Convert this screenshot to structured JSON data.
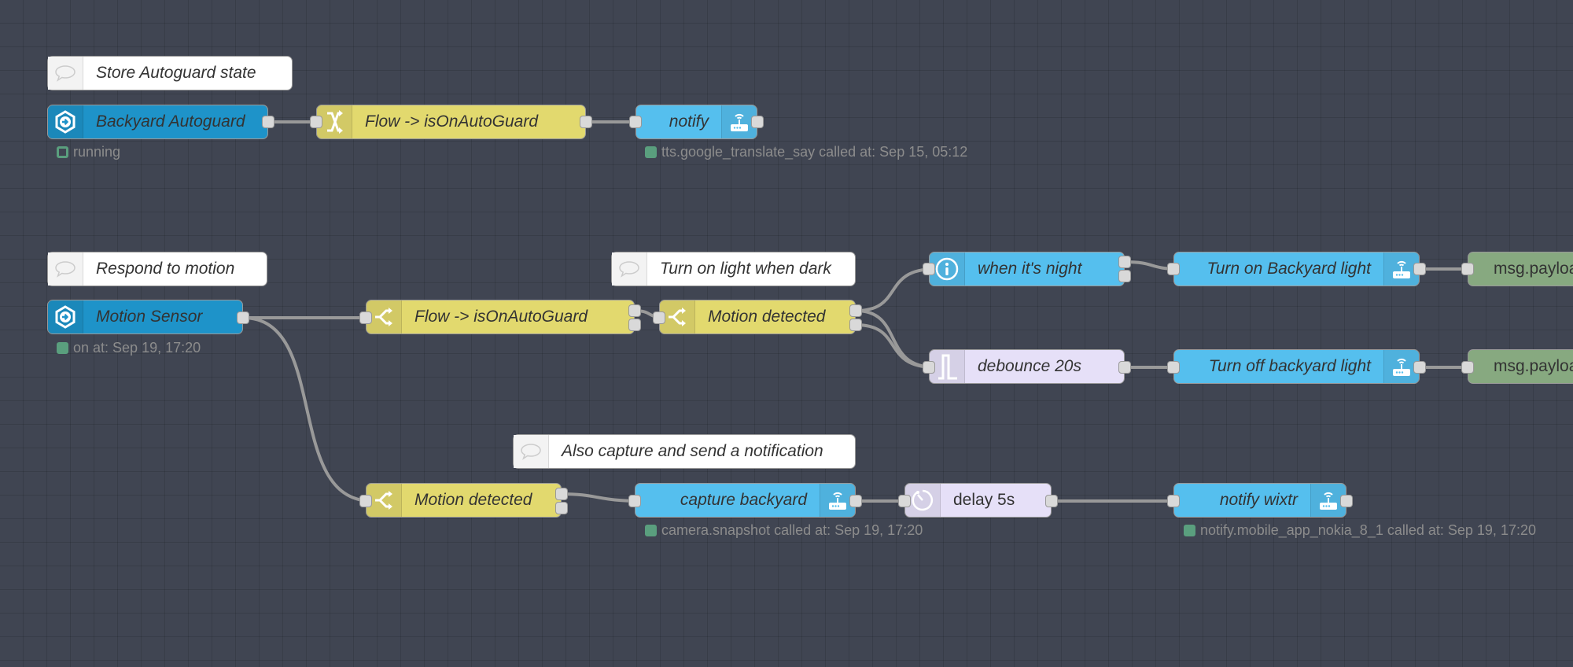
{
  "colors": {
    "canvas": "#404552",
    "ha_server_node": "#1e93c9",
    "ha_service_node": "#55bfee",
    "function_node": "#e2d96e",
    "timing_node": "#e6e0f8",
    "output_node": "#87a980",
    "comment_node": "#ffffff",
    "wire": "#999999",
    "status_ok": "#5a9f7e"
  },
  "flow1": {
    "comment": "Store Autoguard state",
    "trigger": {
      "label": "Backyard Autoguard",
      "icon": "ha-event-icon",
      "status": "running",
      "status_shape": "ring"
    },
    "change": {
      "label": "Flow -> isOnAutoGuard",
      "icon": "shuffle-icon"
    },
    "service": {
      "label": "notify",
      "icon": "router-icon",
      "status": "tts.google_translate_say called at: Sep 15, 05:12"
    }
  },
  "flow2": {
    "comment": "Respond to motion",
    "sensor": {
      "label": "Motion Sensor",
      "icon": "ha-event-icon",
      "status": "on at: Sep 19, 17:20"
    },
    "switch_guard": {
      "label": "Flow -> isOnAutoGuard",
      "icon": "switch-icon"
    },
    "comment_light": "Turn on light when dark",
    "switch_motion_light": {
      "label": "Motion detected",
      "icon": "switch-icon"
    },
    "night_check": {
      "label": "when it's night",
      "icon": "info-icon"
    },
    "debounce": {
      "label": "debounce 20s",
      "icon": "pulse-icon"
    },
    "light_on": {
      "label": "Turn on Backyard light",
      "icon": "router-icon"
    },
    "light_off": {
      "label": "Turn off backyard light",
      "icon": "router-icon"
    },
    "debug_on": {
      "label": "msg.payload"
    },
    "debug_off": {
      "label": "msg.payload"
    },
    "comment_capture": "Also capture and send a notification",
    "switch_motion_capture": {
      "label": "Motion detected",
      "icon": "switch-icon"
    },
    "capture": {
      "label": "capture backyard",
      "icon": "router-icon",
      "status": "camera.snapshot called at: Sep 19, 17:20"
    },
    "delay": {
      "label": "delay 5s",
      "icon": "timer-icon"
    },
    "notify": {
      "label": "notify wixtr",
      "icon": "router-icon",
      "status": "notify.mobile_app_nokia_8_1 called at: Sep 19, 17:20"
    }
  }
}
